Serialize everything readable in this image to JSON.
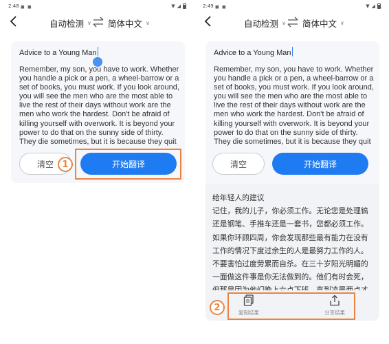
{
  "screens": [
    {
      "id": "input",
      "status": {
        "time": "2:48"
      },
      "header": {
        "source_lang": "自动检测",
        "target_lang": "简体中文"
      },
      "input": {
        "title": "Advice to a Young Man",
        "body": "Remember, my son, you have to work. Whether you handle a pick or a pen, a wheel-barrow or a set of books, you must work. If you look around, you will see the men who are the most able to live the rest of their days without work are the men who work the hardest. Don't be afraid of killing yourself with overwork. It is beyond your power to do that on the sunny side of thirty. They die sometimes, but it is because they quit work at six in the evening"
      },
      "buttons": {
        "clear": "清空",
        "translate": "开始翻译"
      },
      "marker": "1"
    },
    {
      "id": "result",
      "status": {
        "time": "2:49"
      },
      "header": {
        "source_lang": "自动检测",
        "target_lang": "简体中文"
      },
      "input": {
        "title": "Advice to a Young Man",
        "body": "Remember, my son, you have to work. Whether you handle a pick or a pen, a wheel-barrow or a set of books, you must work. If you look around, you will see the men who are the most able to live the rest of their days without work are the men who work the hardest. Don't be afraid of killing yourself with overwork. It is beyond your power to do that on the sunny side of thirty. They die sometimes, but it is because they quit work at six in the evening"
      },
      "buttons": {
        "clear": "清空",
        "translate": "开始翻译"
      },
      "result": {
        "title": "给年轻人的建议",
        "body": "记住，我的儿子，你必须工作。无论您是处理镐还是钢笔、手推车还是一套书，您都必须工作。如果你环顾四周，你会发现那些最有能力在没有工作的情况下度过余生的人是最努力工作的人。不要害怕过度劳累而自杀。在三十岁阳光明媚的一面做这件事是你无法做到的。他们有时会死，但那是因为他们晚上六点下班，直到凌晨两点才回家。是间隔杀人，我的儿"
      },
      "actions": {
        "copy": "复制结果",
        "share": "分享结果"
      },
      "marker": "2"
    }
  ],
  "colors": {
    "accent": "#1f7bf2",
    "highlight": "#e8843f",
    "card_bg": "#f5f7fb"
  }
}
